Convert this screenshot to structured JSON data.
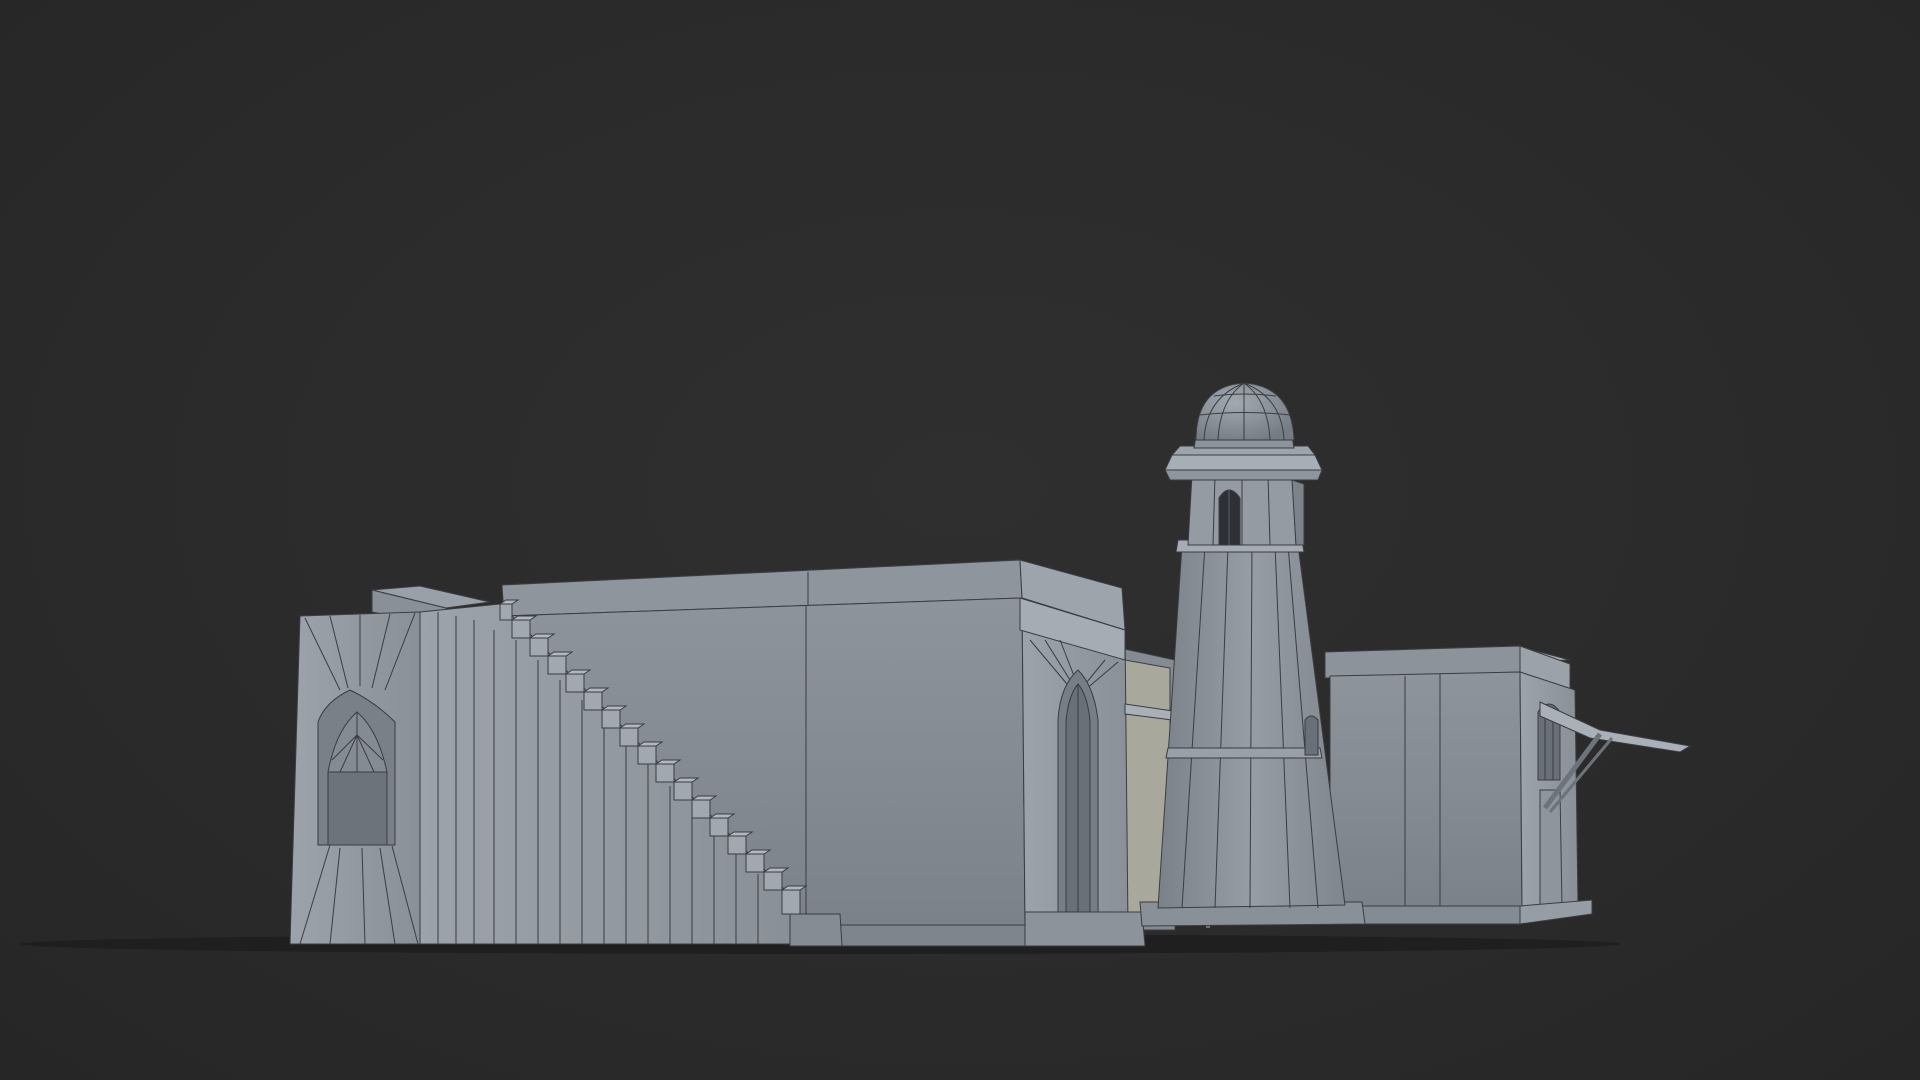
{
  "scene": {
    "background_color": "#2b2b2b",
    "model_color": "#8f949b",
    "wire_color": "#3a3d42",
    "shadow_color": "#1a1a1a",
    "objects": [
      "left-staircase-building",
      "central-domed-tower",
      "right-annex-building",
      "awning-canopies"
    ]
  }
}
